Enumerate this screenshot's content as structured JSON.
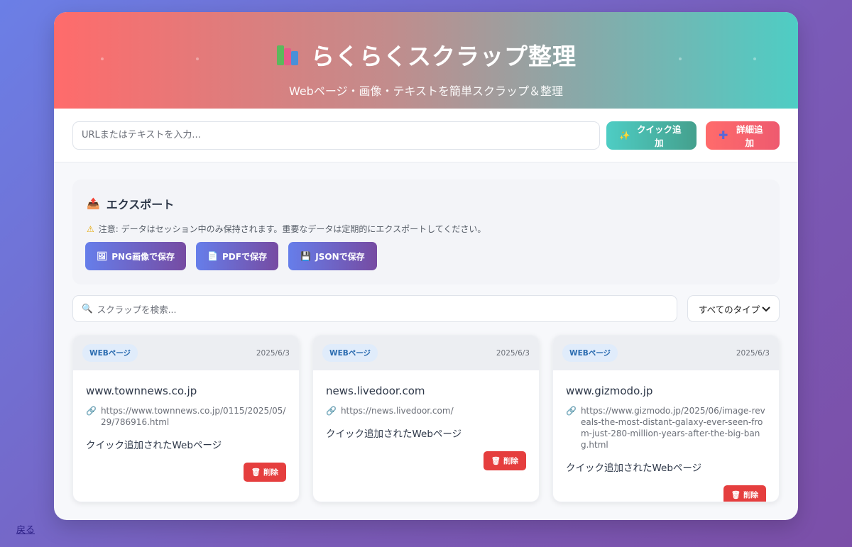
{
  "header": {
    "title": "らくらくスクラップ整理",
    "subtitle": "Webページ・画像・テキストを簡単スクラップ＆整理"
  },
  "add_bar": {
    "placeholder": "URLまたはテキストを入力...",
    "quick_add_label": "クイック追加",
    "detail_add_label": "詳細追加"
  },
  "export": {
    "title": "エクスポート",
    "note": "注意: データはセッション中のみ保持されます。重要なデータは定期的にエクスポートしてください。",
    "buttons": [
      {
        "label": "PNG画像で保存"
      },
      {
        "label": "PDFで保存"
      },
      {
        "label": "JSONで保存"
      }
    ]
  },
  "search": {
    "placeholder": "スクラップを検索...",
    "type_filter": "すべてのタイプ"
  },
  "cards": [
    {
      "badge": "WEBページ",
      "date": "2025/6/3",
      "title": "www.townnews.co.jp",
      "url": "https://www.townnews.co.jp/0115/2025/05/29/786916.html",
      "description": "クイック追加されたWebページ",
      "delete_label": "削除"
    },
    {
      "badge": "WEBページ",
      "date": "2025/6/3",
      "title": "news.livedoor.com",
      "url": "https://news.livedoor.com/",
      "description": "クイック追加されたWebページ",
      "delete_label": "削除"
    },
    {
      "badge": "WEBページ",
      "date": "2025/6/3",
      "title": "www.gizmodo.jp",
      "url": "https://www.gizmodo.jp/2025/06/image-reveals-the-most-distant-galaxy-ever-seen-from-just-280-million-years-after-the-big-bang.html",
      "description": "クイック追加されたWebページ",
      "delete_label": "削除"
    }
  ],
  "back_link": "戻る",
  "colors": {
    "accent_start": "#667eea",
    "accent_end": "#764ba2",
    "quick_add": "#4ecdc4",
    "detail_add": "#ff6b6b",
    "delete": "#e53e3e"
  }
}
